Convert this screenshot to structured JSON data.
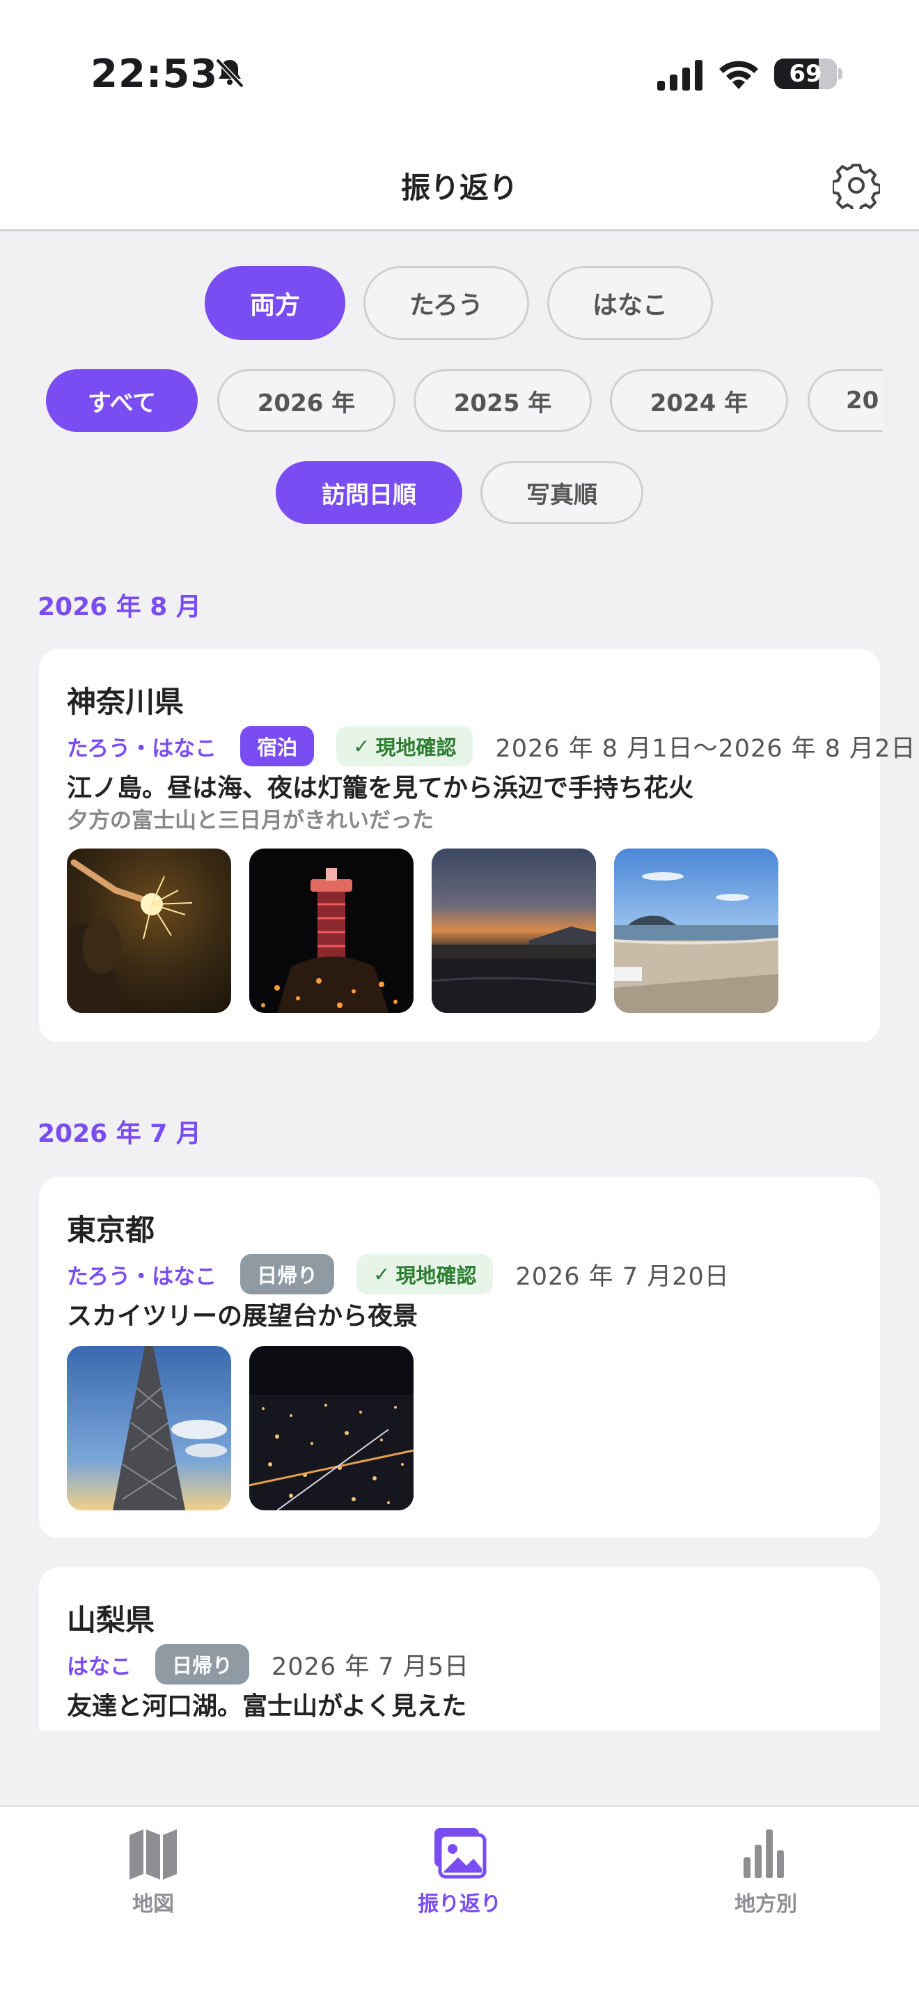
{
  "status_bar": {
    "time": "22:53",
    "battery": "69"
  },
  "header": {
    "title": "振り返り"
  },
  "person_filter": {
    "options": [
      "両方",
      "たろう",
      "はなこ"
    ],
    "selected": "両方"
  },
  "year_filter": {
    "options": [
      "すべて",
      "2026 年",
      "2025 年",
      "2024 年",
      "20"
    ],
    "selected": "すべて"
  },
  "sort_filter": {
    "options": [
      "訪問日順",
      "写真順"
    ],
    "selected": "訪問日順"
  },
  "sections": [
    {
      "title": "2026 年 8 月",
      "entries": [
        {
          "prefecture": "神奈川県",
          "people": "たろう・はなこ",
          "trip_type": "宿泊",
          "verified": "現地確認",
          "date": "2026 年 8 月1日〜2026 年 8 月2日",
          "note": "江ノ島。昼は海、夜は灯籠を見てから浜辺で手持ち花火",
          "subnote": "夕方の富士山と三日月がきれいだった",
          "photos": [
            "sparkler-photo",
            "lighthouse-night-photo",
            "sunset-coast-photo",
            "beach-day-photo"
          ]
        }
      ]
    },
    {
      "title": "2026 年 7 月",
      "entries": [
        {
          "prefecture": "東京都",
          "people": "たろう・はなこ",
          "trip_type": "日帰り",
          "verified": "現地確認",
          "date": "2026 年 7 月20日",
          "note": "スカイツリーの展望台から夜景",
          "photos": [
            "skytree-photo",
            "city-night-photo"
          ]
        },
        {
          "prefecture": "山梨県",
          "people": "はなこ",
          "trip_type": "日帰り",
          "date": "2026 年 7 月5日",
          "note": "友達と河口湖。富士山がよく見えた"
        }
      ]
    }
  ],
  "tab_bar": {
    "items": [
      {
        "label": "地図",
        "icon": "map-icon"
      },
      {
        "label": "振り返り",
        "icon": "photo-album-icon"
      },
      {
        "label": "地方別",
        "icon": "bar-chart-icon"
      }
    ],
    "selected": "振り返り"
  },
  "colors": {
    "accent": "#7a4df3",
    "day_tag": "#8f9aa3",
    "verified_bg": "#e6f5e8",
    "verified_text": "#2e7d32"
  }
}
